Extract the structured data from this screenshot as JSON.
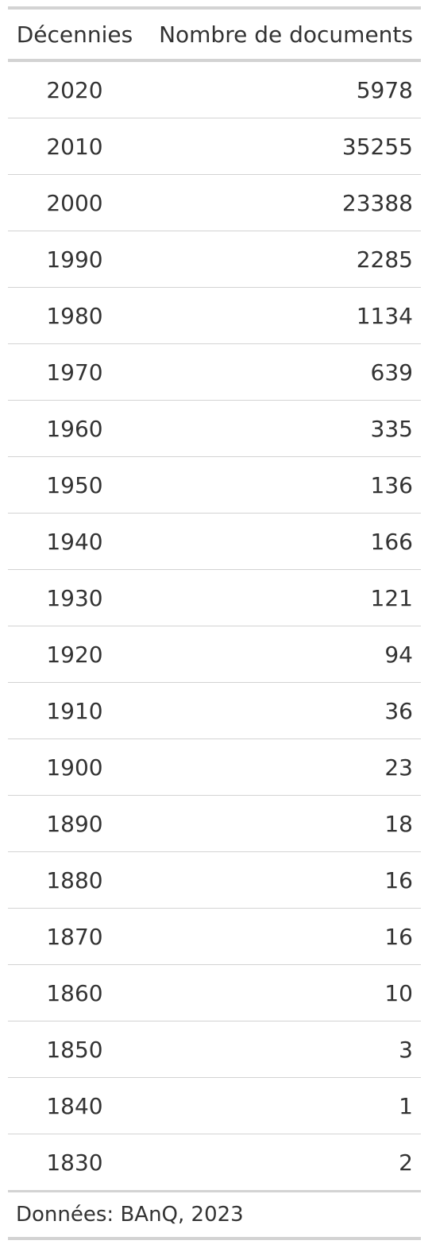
{
  "table": {
    "columns": [
      "Décennies",
      "Nombre de documents"
    ],
    "rows": [
      {
        "decade": "2020",
        "count": "5978"
      },
      {
        "decade": "2010",
        "count": "35255"
      },
      {
        "decade": "2000",
        "count": "23388"
      },
      {
        "decade": "1990",
        "count": "2285"
      },
      {
        "decade": "1980",
        "count": "1134"
      },
      {
        "decade": "1970",
        "count": "639"
      },
      {
        "decade": "1960",
        "count": "335"
      },
      {
        "decade": "1950",
        "count": "136"
      },
      {
        "decade": "1940",
        "count": "166"
      },
      {
        "decade": "1930",
        "count": "121"
      },
      {
        "decade": "1920",
        "count": "94"
      },
      {
        "decade": "1910",
        "count": "36"
      },
      {
        "decade": "1900",
        "count": "23"
      },
      {
        "decade": "1890",
        "count": "18"
      },
      {
        "decade": "1880",
        "count": "16"
      },
      {
        "decade": "1870",
        "count": "16"
      },
      {
        "decade": "1860",
        "count": "10"
      },
      {
        "decade": "1850",
        "count": "3"
      },
      {
        "decade": "1840",
        "count": "1"
      },
      {
        "decade": "1830",
        "count": "2"
      }
    ],
    "source_note": "Données: BAnQ, 2023"
  }
}
